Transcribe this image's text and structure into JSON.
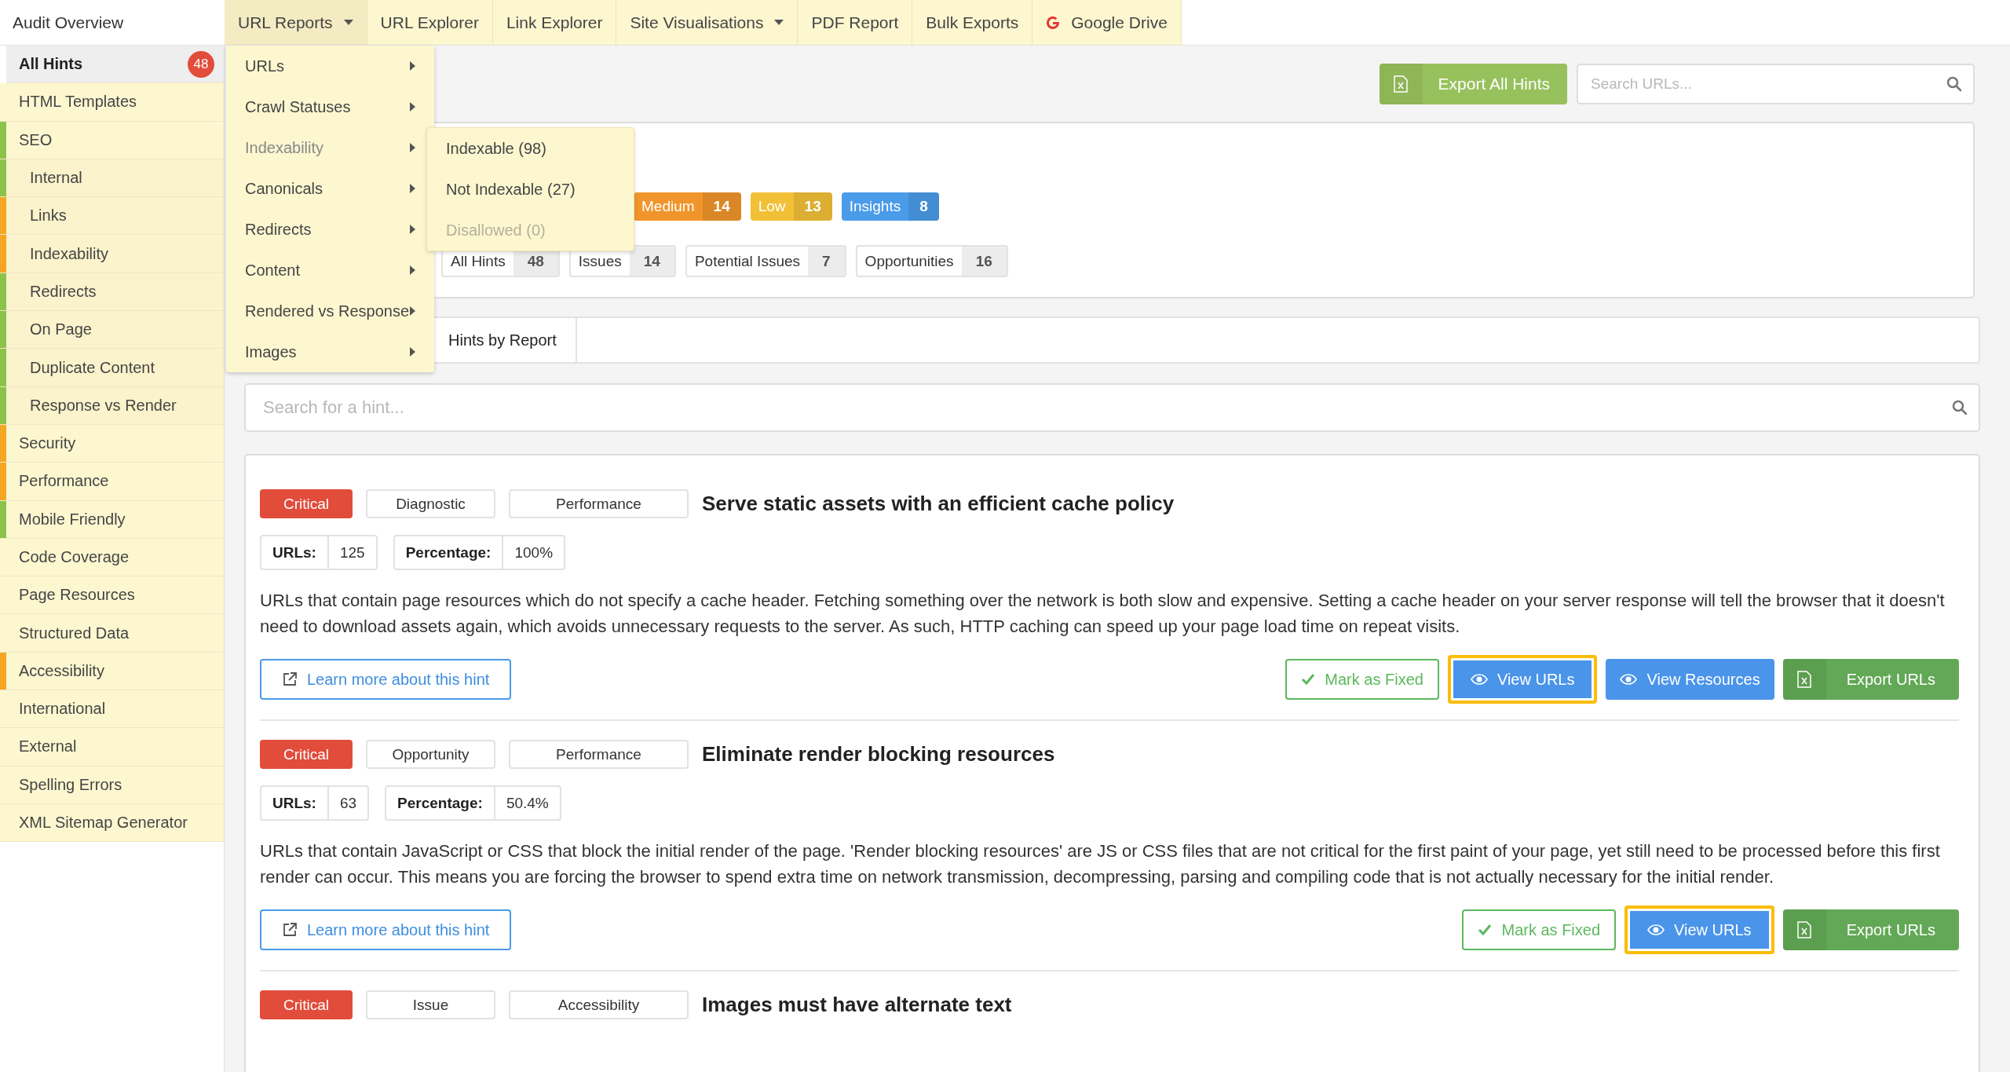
{
  "nav": {
    "title": "Audit Overview",
    "items": [
      {
        "label": "URL Reports",
        "kind": "dropdown",
        "expanded": true
      },
      {
        "label": "URL Explorer",
        "kind": "link",
        "expanded": false
      },
      {
        "label": "Link Explorer",
        "kind": "link",
        "expanded": false
      },
      {
        "label": "Site Visualisations",
        "kind": "dropdown",
        "expanded": false
      },
      {
        "label": "PDF Report",
        "kind": "link",
        "expanded": false
      },
      {
        "label": "Bulk Exports",
        "kind": "link",
        "expanded": false
      },
      {
        "label": "Google Drive",
        "kind": "google",
        "expanded": false
      }
    ]
  },
  "url_menu": {
    "items": [
      {
        "label": "URLs",
        "expanded": false
      },
      {
        "label": "Crawl Statuses",
        "expanded": false
      },
      {
        "label": "Indexability",
        "expanded": true,
        "children": [
          {
            "label": "Indexable (98)",
            "disabled": false
          },
          {
            "label": "Not Indexable (27)",
            "disabled": false
          },
          {
            "label": "Disallowed (0)",
            "disabled": true
          }
        ]
      },
      {
        "label": "Canonicals",
        "expanded": false
      },
      {
        "label": "Redirects",
        "expanded": false
      },
      {
        "label": "Content",
        "expanded": false
      },
      {
        "label": "Rendered vs Response",
        "expanded": false
      },
      {
        "label": "Images",
        "expanded": false
      }
    ]
  },
  "sidebar": {
    "items": [
      {
        "label": "All Hints",
        "count": "48",
        "selected": true
      },
      {
        "label": "HTML Templates",
        "selected": false
      },
      {
        "label": "SEO",
        "selected": false,
        "color": "#8bc34a",
        "children": [
          {
            "label": "Internal",
            "selected": false,
            "color": "#8bc34a"
          },
          {
            "label": "Links",
            "selected": false,
            "color": "#f5a623"
          },
          {
            "label": "Indexability",
            "selected": false,
            "color": "#f5a623"
          },
          {
            "label": "Redirects",
            "selected": false,
            "color": "#8bc34a"
          },
          {
            "label": "On Page",
            "selected": false,
            "color": "#8bc34a"
          },
          {
            "label": "Duplicate Content",
            "selected": false,
            "color": "#8bc34a"
          },
          {
            "label": "Response vs Render",
            "selected": false,
            "color": "#8bc34a"
          }
        ]
      },
      {
        "label": "Security",
        "selected": false,
        "color": "#f5a623"
      },
      {
        "label": "Performance",
        "selected": false,
        "color": "#f5a623"
      },
      {
        "label": "Mobile Friendly",
        "selected": false,
        "color": "#8bc34a"
      },
      {
        "label": "Code Coverage",
        "selected": false
      },
      {
        "label": "Page Resources",
        "selected": false
      },
      {
        "label": "Structured Data",
        "selected": false
      },
      {
        "label": "Accessibility",
        "selected": false,
        "color": "#f5a623"
      },
      {
        "label": "International",
        "selected": false
      },
      {
        "label": "External",
        "selected": false
      },
      {
        "label": "Spelling Errors",
        "selected": false
      },
      {
        "label": "XML Sitemap Generator",
        "selected": false
      }
    ]
  },
  "toolbar": {
    "export_button": "Export All Hints",
    "search": {
      "placeholder": "Search URLs..."
    }
  },
  "summary": {
    "severities": [
      {
        "label": "Medium",
        "count": "14",
        "color": "#f0952b"
      },
      {
        "label": "Low",
        "count": "13",
        "color": "#f2c037"
      },
      {
        "label": "Insights",
        "count": "8",
        "color": "#4a9be8"
      }
    ],
    "filters": [
      {
        "label": "All Hints",
        "count": "48"
      },
      {
        "label": "Issues",
        "count": "14"
      },
      {
        "label": "Potential Issues",
        "count": "7"
      },
      {
        "label": "Opportunities",
        "count": "16"
      }
    ]
  },
  "tabs": [
    {
      "label": "Hints by Report",
      "selected": false
    }
  ],
  "hint_search": {
    "placeholder": "Search for a hint..."
  },
  "hints": [
    {
      "severity": {
        "label": "Critical",
        "color": "#e24c3b"
      },
      "tags": [
        "Diagnostic",
        "Performance"
      ],
      "title": "Serve static assets with an efficient cache policy",
      "stats": [
        {
          "label": "URLs:",
          "value": "125"
        },
        {
          "label": "Percentage:",
          "value": "100%"
        }
      ],
      "description": "URLs that contain page resources which do not specify a cache header. Fetching something over the network is both slow and expensive. Setting a cache header on your server response will tell the browser that it doesn't need to download assets again, which avoids unnecessary requests to the server. As such, HTTP caching can speed up your page load time on repeat visits.",
      "learn_more": "Learn more about this hint",
      "buttons": [
        {
          "kind": "mark_fixed",
          "label": "Mark as Fixed",
          "highlighted": false
        },
        {
          "kind": "view",
          "label": "View URLs",
          "highlighted": true
        },
        {
          "kind": "view",
          "label": "View Resources",
          "highlighted": false
        },
        {
          "kind": "export",
          "label": "Export URLs",
          "highlighted": false
        }
      ]
    },
    {
      "severity": {
        "label": "Critical",
        "color": "#e24c3b"
      },
      "tags": [
        "Opportunity",
        "Performance"
      ],
      "title": "Eliminate render blocking resources",
      "stats": [
        {
          "label": "URLs:",
          "value": "63"
        },
        {
          "label": "Percentage:",
          "value": "50.4%"
        }
      ],
      "description": "URLs that contain JavaScript or CSS that block the initial render of the page. 'Render blocking resources' are JS or CSS files that are not critical for the first paint of your page, yet still need to be processed before this first render can occur. This means you are forcing the browser to spend extra time on network transmission, decompressing, parsing and compiling code that is not actually necessary for the initial render.",
      "learn_more": "Learn more about this hint",
      "buttons": [
        {
          "kind": "mark_fixed",
          "label": "Mark as Fixed",
          "highlighted": false
        },
        {
          "kind": "view",
          "label": "View URLs",
          "highlighted": true
        },
        {
          "kind": "export",
          "label": "Export URLs",
          "highlighted": false
        }
      ]
    },
    {
      "severity": {
        "label": "Critical",
        "color": "#e24c3b"
      },
      "tags": [
        "Issue",
        "Accessibility"
      ],
      "title": "Images must have alternate text"
    }
  ]
}
